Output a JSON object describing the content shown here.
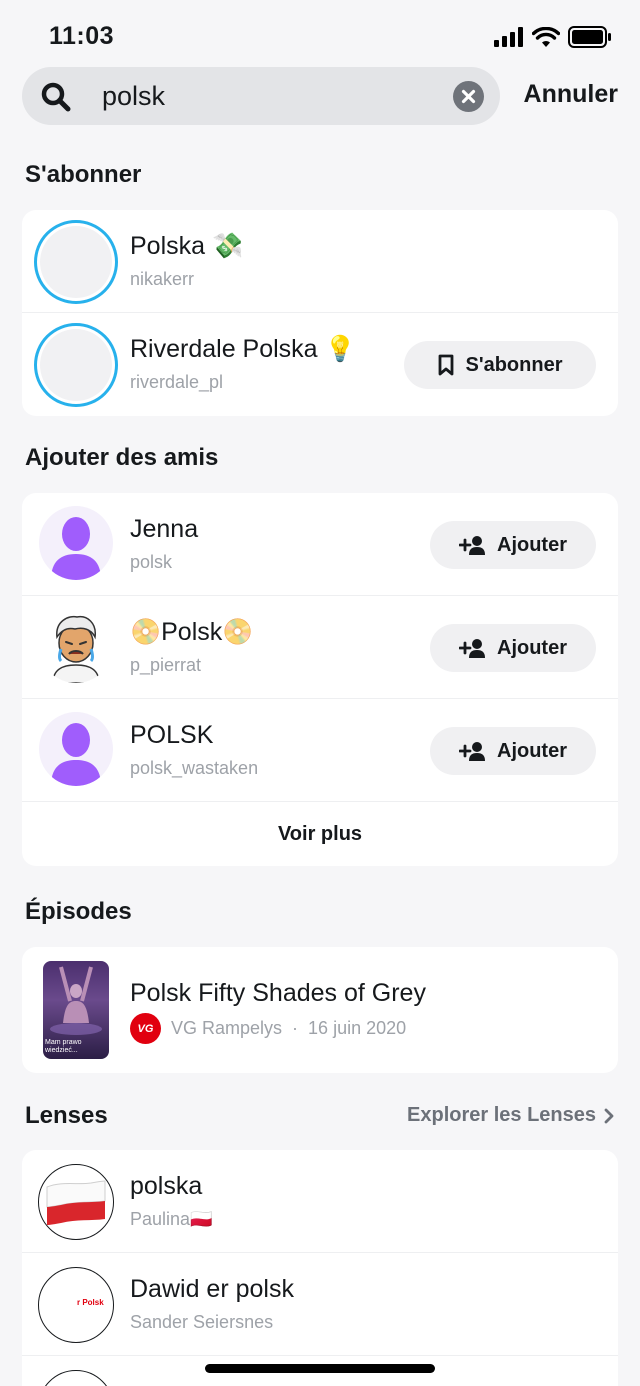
{
  "status_bar": {
    "time": "11:03"
  },
  "search": {
    "query": "polsk",
    "cancel_label": "Annuler"
  },
  "subscribe_section": {
    "title": "S'abonner",
    "items": [
      {
        "name": "Polska 💸",
        "username": "nikakerr"
      },
      {
        "name": "Riverdale Polska 💡",
        "username": "riverdale_pl",
        "button_label": "S'abonner"
      }
    ]
  },
  "friends_section": {
    "title": "Ajouter des amis",
    "items": [
      {
        "name": "Jenna",
        "username": "polsk",
        "button_label": "Ajouter"
      },
      {
        "name": "📀Polsk📀",
        "username": "p_pierrat",
        "button_label": "Ajouter"
      },
      {
        "name": "POLSK",
        "username": "polsk_wastaken",
        "button_label": "Ajouter"
      }
    ],
    "more_label": "Voir plus"
  },
  "episodes_section": {
    "title": "Épisodes",
    "items": [
      {
        "title": "Polsk Fifty Shades of Grey",
        "publisher": "VG Rampelys",
        "separator": "·",
        "date": "16 juin 2020",
        "thumb_caption": "Mam prawo wiedzieć...",
        "badge": "VG"
      }
    ]
  },
  "lenses_section": {
    "title": "Lenses",
    "explore_label": "Explorer les Lenses",
    "items": [
      {
        "name": "polska",
        "creator": "Paulina🇵🇱"
      },
      {
        "name": "Dawid er polsk",
        "creator": "Sander Seiersnes",
        "thumb_text": "r Polsk"
      }
    ]
  },
  "colors": {
    "ring": "#27b1ec",
    "bitmoji_purple": "#a05dfc",
    "vg_red": "#e1000f"
  }
}
